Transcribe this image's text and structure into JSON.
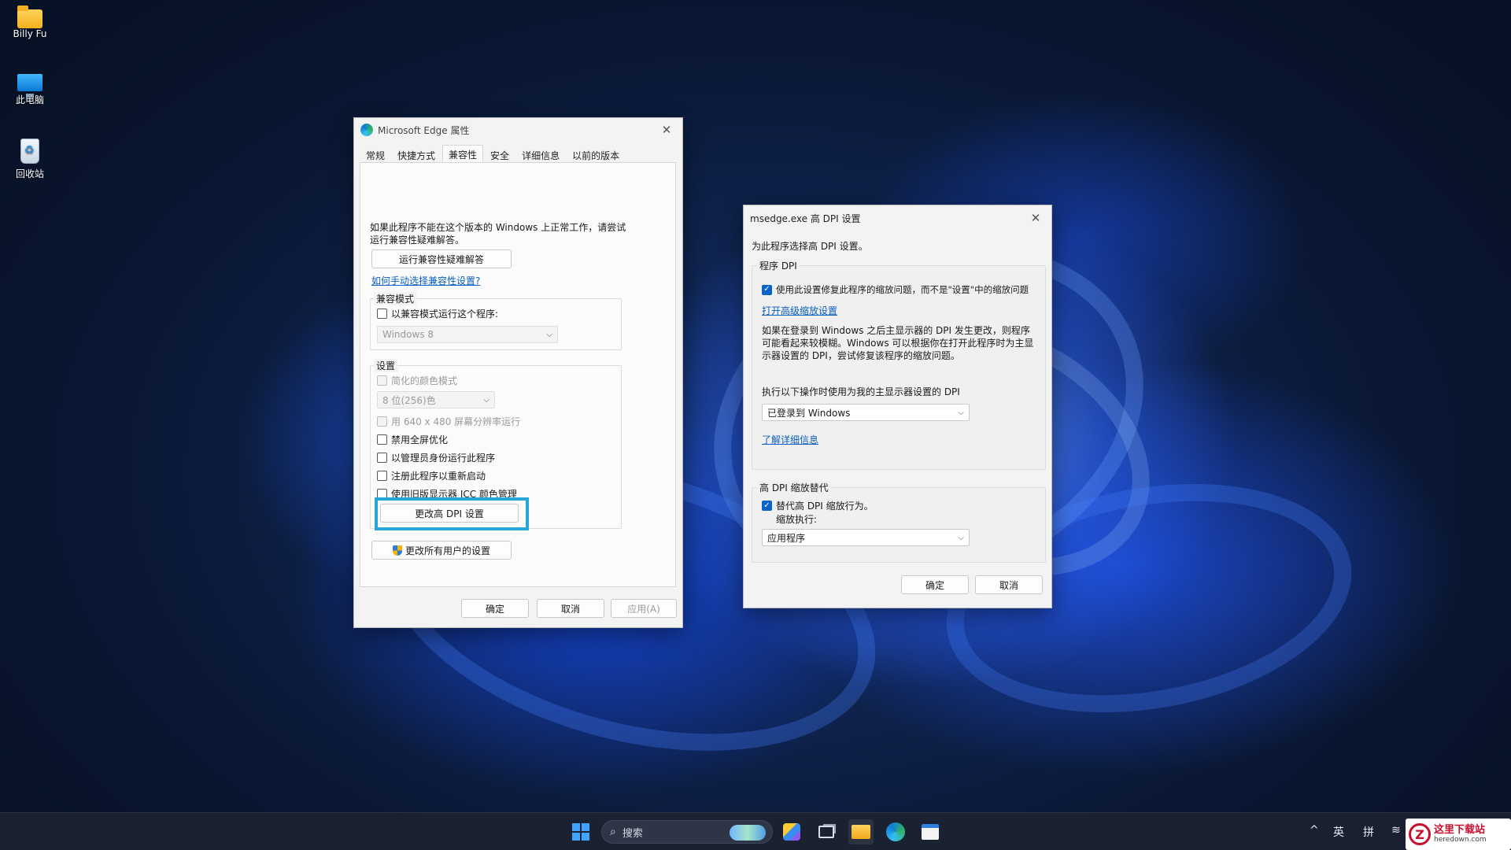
{
  "desktop": {
    "icons": [
      {
        "label": "Billy Fu",
        "icon": "folder-icon"
      },
      {
        "label": "此电脑",
        "icon": "computer-icon"
      },
      {
        "label": "回收站",
        "icon": "recycle-bin-icon"
      }
    ]
  },
  "props_window": {
    "title": "Microsoft Edge 属性",
    "tabs": [
      "常规",
      "快捷方式",
      "兼容性",
      "安全",
      "详细信息",
      "以前的版本"
    ],
    "active_tab": "兼容性",
    "intro": "如果此程序不能在这个版本的 Windows 上正常工作，请尝试运行兼容性疑难解答。",
    "troubleshoot_button": "运行兼容性疑难解答",
    "manual_link": "如何手动选择兼容性设置?",
    "compat_group_label": "兼容模式",
    "compat_checkbox": "以兼容模式运行这个程序:",
    "compat_select": "Windows 8",
    "settings_group_label": "设置",
    "settings": [
      {
        "label": "简化的颜色模式",
        "checked": false,
        "disabled": true
      },
      {
        "label": "用 640 x 480 屏幕分辨率运行",
        "checked": false,
        "disabled": true
      },
      {
        "label": "禁用全屏优化",
        "checked": false,
        "disabled": false
      },
      {
        "label": "以管理员身份运行此程序",
        "checked": false,
        "disabled": false
      },
      {
        "label": "注册此程序以重新启动",
        "checked": false,
        "disabled": false
      },
      {
        "label": "使用旧版显示器 ICC 颜色管理",
        "checked": false,
        "disabled": false
      }
    ],
    "color_select": "8 位(256)色",
    "dpi_button": "更改高 DPI 设置",
    "all_users_button": "更改所有用户的设置",
    "ok": "确定",
    "cancel": "取消",
    "apply": "应用(A)"
  },
  "dpi_window": {
    "title": "msedge.exe 高 DPI 设置",
    "intro": "为此程序选择高 DPI 设置。",
    "program_dpi_label": "程序 DPI",
    "program_dpi_checkbox": "使用此设置修复此程序的缩放问题，而不是\"设置\"中的缩放问题",
    "program_dpi_checked": true,
    "advanced_link": "打开高级缩放设置",
    "description": "如果在登录到 Windows 之后主显示器的 DPI 发生更改，则程序可能看起来较模糊。Windows 可以根据你在打开此程序时为主显示器设置的 DPI，尝试修复该程序的缩放问题。",
    "when_label": "执行以下操作时使用为我的主显示器设置的 DPI",
    "when_select": "已登录到 Windows",
    "learn_more_link": "了解详细信息",
    "override_label": "高 DPI 缩放替代",
    "override_checkbox": "替代高 DPI 缩放行为。",
    "override_checked": true,
    "scaling_by": "缩放执行:",
    "scaling_select": "应用程序",
    "ok": "确定",
    "cancel": "取消"
  },
  "taskbar": {
    "search_placeholder": "搜索",
    "tray_lang": "英",
    "tray_ime": "拼"
  },
  "watermark": {
    "cn": "这里下载站",
    "en": "heredown.com",
    "logo": "Z"
  },
  "colors": {
    "accent": "#0a64c8",
    "highlight": "#29a6d8"
  }
}
